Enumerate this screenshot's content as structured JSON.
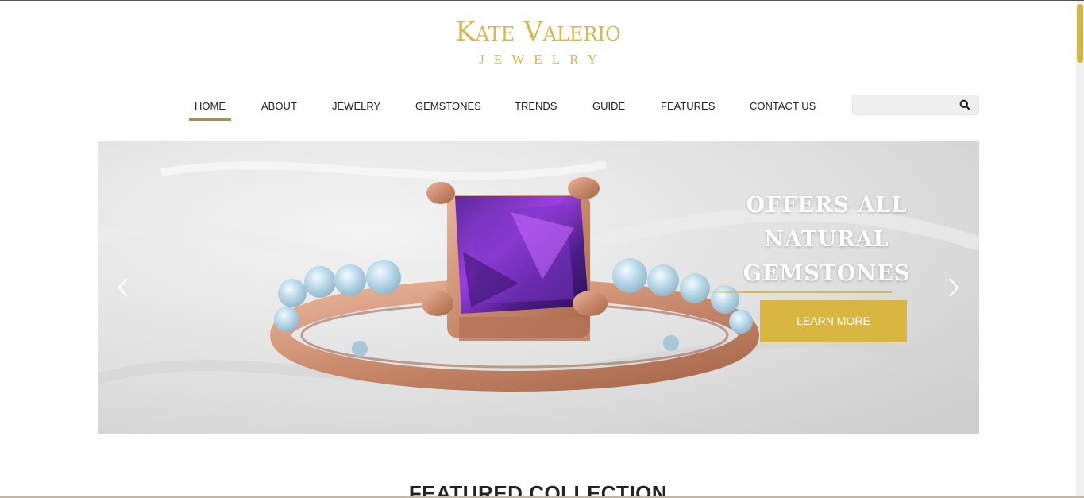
{
  "brand": {
    "name": "Kate Valerio",
    "sub": "JEWELRY",
    "color": "#d9b84a"
  },
  "nav": {
    "items": [
      {
        "label": "HOME",
        "active": true
      },
      {
        "label": "ABOUT"
      },
      {
        "label": "JEWELRY"
      },
      {
        "label": "GEMSTONES"
      },
      {
        "label": "TRENDS"
      },
      {
        "label": "GUIDE"
      },
      {
        "label": "FEATURES"
      },
      {
        "label": "CONTACT US"
      }
    ],
    "accent": "#b08f3b"
  },
  "search": {
    "value": "",
    "placeholder": "",
    "icon": "search-icon"
  },
  "hero": {
    "title": "OFFERS ALL NATURAL GEMSTONES",
    "button_label": "LEARN MORE",
    "button_color": "#d9b63f",
    "prev_icon": "chevron-left-icon",
    "next_icon": "chevron-right-icon"
  },
  "featured": {
    "heading": "FEATURED COLLECTION"
  }
}
